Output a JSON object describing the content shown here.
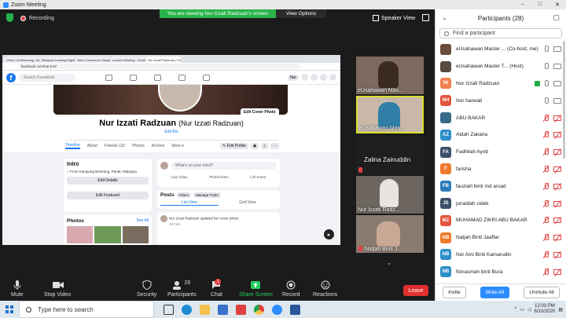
{
  "window": {
    "title": "Zoom Meeting"
  },
  "topbar": {
    "recording_label": "Recording",
    "viewing_banner": "You are viewing Nur Izzati Radzuan's screen",
    "view_options": "View Options",
    "speaker_view": "Speaker View"
  },
  "shared_screen": {
    "browser_tabs": [
      "Video Conferencing, Web Conf...",
      "Malaysia Leading Digital Rem...",
      "Silica Commerce Management...",
      "Launch Meeting - Zoom",
      "Nur Izzati Radzuan | Facebook"
    ],
    "url": "facebook.com/nur.k.57",
    "fb_search_placeholder": "Search Facebook",
    "fb_user": "Nur",
    "edit_cover": "Edit Cover Photo",
    "name": "Nur Izzati Radzuan",
    "name_alt": "(Nur Izzati Radzuan)",
    "edit_bio": "Edit Bio",
    "tabs": [
      "Timeline",
      "About",
      "Friends 122",
      "Photos",
      "Archive",
      "More ▾"
    ],
    "edit_profile": "✎ Edit Profile",
    "intro_title": "Intro",
    "intro_location": "From Kampung Beheang, Perak, Malaysia",
    "edit_details": "Edit Details",
    "edit_featured": "Edit Featured",
    "photos_title": "Photos",
    "see_all": "See All",
    "mind_placeholder": "What's on your mind?",
    "post_actions": [
      "Live Video",
      "Photo/Video",
      "Life Event"
    ],
    "posts_title": "Posts",
    "filters": "Filters",
    "manage_posts": "Manage Posts",
    "list_view": "List View",
    "grid_view": "Grid View",
    "post_text": "Nur Izzati Radzuan updated her cover photo.",
    "post_time": "18 Feb"
  },
  "tiles": [
    {
      "name": "eUsahawan Mas..."
    },
    {
      "name": "eUsahawan Mas..."
    },
    {
      "name": "Zalina Zainuddin"
    },
    {
      "name": "Nur Izzati Radz..."
    },
    {
      "name": "Natjah Binti J..."
    }
  ],
  "toolbar": {
    "mute": "Mute",
    "stop_video": "Stop Video",
    "security": "Security",
    "participants": "Participants",
    "participant_count": "28",
    "chat": "Chat",
    "chat_badge": "1",
    "share_screen": "Share Screen",
    "record": "Record",
    "reactions": "Reactions",
    "end": "Leave"
  },
  "panel": {
    "title": "Participants (28)",
    "find_placeholder": "Find a participant",
    "participants": [
      {
        "initials": "",
        "name": "eUsahawan Master ... (Co-host, me)",
        "color": "#6b4b3a",
        "muted": false,
        "cam_off": false
      },
      {
        "initials": "",
        "name": "eUsahawan Master T... (Host)",
        "color": "#5a4a40",
        "muted": false,
        "cam_off": false
      },
      {
        "initials": "NI",
        "name": "Nur Izzati Radzuan",
        "color": "#f08050",
        "muted": false,
        "cam_off": false
      },
      {
        "initials": "NH",
        "name": "Nor harwati",
        "color": "#e2553c",
        "muted": false,
        "cam_off": false
      },
      {
        "initials": "",
        "name": "ABU BAKAR",
        "color": "#3a6a8a",
        "muted": true,
        "cam_off": true
      },
      {
        "initials": "AZ",
        "name": "Aidah Zakaria",
        "color": "#2c8fc9",
        "muted": true,
        "cam_off": true
      },
      {
        "initials": "FA",
        "name": "Fadhilah Ayob",
        "color": "#3b5068",
        "muted": true,
        "cam_off": true
      },
      {
        "initials": "F",
        "name": "farisha",
        "color": "#f07a2c",
        "muted": true,
        "cam_off": true
      },
      {
        "initials": "FB",
        "name": "fauziah binti md arsad",
        "color": "#2c7bb9",
        "muted": true,
        "cam_off": true
      },
      {
        "initials": "JS",
        "name": "junaidah sidek",
        "color": "#3b5068",
        "muted": true,
        "cam_off": true
      },
      {
        "initials": "MZ",
        "name": "MUHAMAD ZIKRI ABU BAKAR",
        "color": "#e2553c",
        "muted": true,
        "cam_off": true
      },
      {
        "initials": "NB",
        "name": "Natjah Binti Jaaffar",
        "color": "#f07a2c",
        "muted": true,
        "cam_off": true
      },
      {
        "initials": "NB",
        "name": "Nor Aini Binti Kamarudin",
        "color": "#2c8fc9",
        "muted": true,
        "cam_off": true
      },
      {
        "initials": "NB",
        "name": "Norasmah binti Bura",
        "color": "#2c8fc9",
        "muted": true,
        "cam_off": true
      }
    ],
    "invite": "Invite",
    "mute_all": "Mute All",
    "unmute_all": "Unmute All"
  },
  "taskbar": {
    "search_placeholder": "Type here to search",
    "time": "12:03 PM",
    "date": "6/10/2020"
  }
}
